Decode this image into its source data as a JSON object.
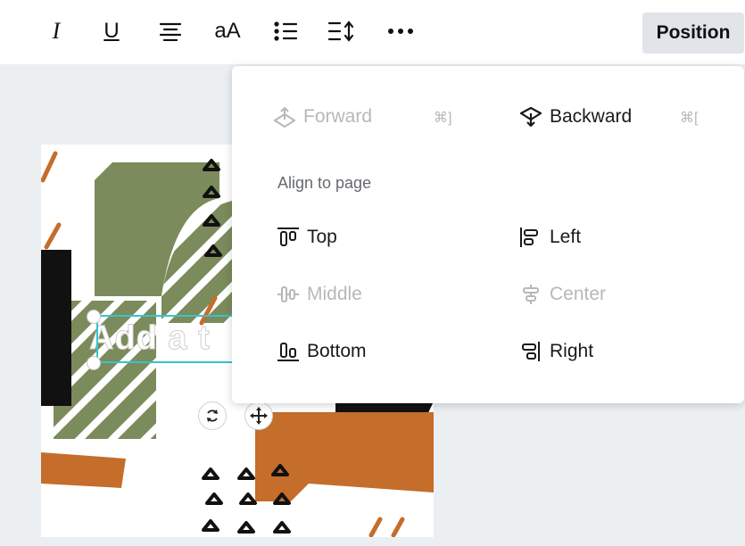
{
  "toolbar": {
    "italic_label": "I",
    "underline_label": "U",
    "case_label": "aA",
    "position_label": "Position",
    "icons": [
      "italic-icon",
      "underline-icon",
      "align-center-icon",
      "letter-case-icon",
      "bullet-list-icon",
      "line-spacing-icon",
      "more-icon"
    ]
  },
  "canvas": {
    "placeholder_text": "Add a t",
    "colors": {
      "green": "#7b8b5b",
      "orange": "#c56d2a",
      "black": "#111111",
      "selection": "#36c3cf"
    }
  },
  "position_menu": {
    "forward": {
      "label": "Forward",
      "shortcut": "⌘]",
      "enabled": false
    },
    "backward": {
      "label": "Backward",
      "shortcut": "⌘[",
      "enabled": true
    },
    "align_heading": "Align to page",
    "top": {
      "label": "Top",
      "enabled": true
    },
    "left": {
      "label": "Left",
      "enabled": true
    },
    "middle": {
      "label": "Middle",
      "enabled": false
    },
    "center": {
      "label": "Center",
      "enabled": false
    },
    "bottom": {
      "label": "Bottom",
      "enabled": true
    },
    "right": {
      "label": "Right",
      "enabled": true
    }
  }
}
